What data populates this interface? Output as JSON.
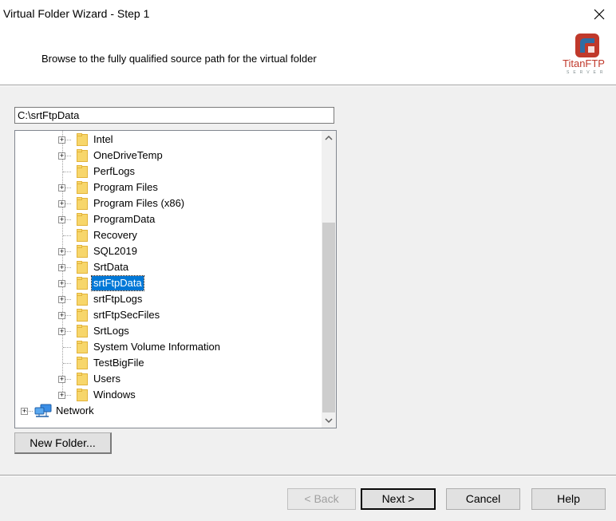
{
  "window": {
    "title": "Virtual Folder Wizard - Step 1"
  },
  "header": {
    "instruction": "Browse to the fully qualified source path for the virtual folder",
    "logo": {
      "brand_titan": "Titan",
      "brand_ftp": "FTP",
      "sub": "SERVER"
    }
  },
  "path": {
    "value": "C:\\srtFtpData"
  },
  "tree": {
    "items": [
      {
        "label": "Intel",
        "expandable": true
      },
      {
        "label": "OneDriveTemp",
        "expandable": true
      },
      {
        "label": "PerfLogs",
        "expandable": false
      },
      {
        "label": "Program Files",
        "expandable": true
      },
      {
        "label": "Program Files (x86)",
        "expandable": true
      },
      {
        "label": "ProgramData",
        "expandable": true
      },
      {
        "label": "Recovery",
        "expandable": false
      },
      {
        "label": "SQL2019",
        "expandable": true
      },
      {
        "label": "SrtData",
        "expandable": true
      },
      {
        "label": "srtFtpData",
        "expandable": true,
        "selected": true
      },
      {
        "label": "srtFtpLogs",
        "expandable": true
      },
      {
        "label": "srtFtpSecFiles",
        "expandable": true
      },
      {
        "label": "SrtLogs",
        "expandable": true
      },
      {
        "label": "System Volume Information",
        "expandable": false
      },
      {
        "label": "TestBigFile",
        "expandable": false
      },
      {
        "label": "Users",
        "expandable": true
      },
      {
        "label": "Windows",
        "expandable": true
      }
    ],
    "network": {
      "label": "Network"
    }
  },
  "buttons": {
    "new_folder": "New Folder...",
    "back": "< Back",
    "next": "Next >",
    "cancel": "Cancel",
    "help": "Help"
  },
  "colors": {
    "selection": "#0078d7",
    "logo_red": "#c0392b",
    "logo_blue": "#2e6da4"
  }
}
